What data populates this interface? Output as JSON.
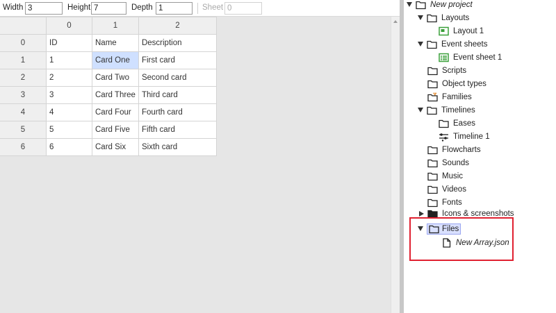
{
  "toolbar": {
    "width_label": "Width",
    "width_value": "3",
    "height_label": "Height",
    "height_value": "7",
    "depth_label": "Depth",
    "depth_value": "1",
    "sheet_label": "Sheet",
    "sheet_value": "0"
  },
  "grid": {
    "columns": [
      "0",
      "1",
      "2"
    ],
    "rows": [
      {
        "index": "0",
        "cells": [
          "ID",
          "Name",
          "Description"
        ]
      },
      {
        "index": "1",
        "cells": [
          "1",
          "Card One",
          "First card"
        ]
      },
      {
        "index": "2",
        "cells": [
          "2",
          "Card Two",
          "Second card"
        ]
      },
      {
        "index": "3",
        "cells": [
          "3",
          "Card Three",
          "Third card"
        ]
      },
      {
        "index": "4",
        "cells": [
          "4",
          "Card Four",
          "Fourth card"
        ]
      },
      {
        "index": "5",
        "cells": [
          "5",
          "Card Five",
          "Fifth card"
        ]
      },
      {
        "index": "6",
        "cells": [
          "6",
          "Card Six",
          "Sixth card"
        ]
      }
    ],
    "selected_cell": "Card One"
  },
  "project": {
    "root": "New project",
    "layouts": "Layouts",
    "layout_1": "Layout 1",
    "event_sheets": "Event sheets",
    "event_sheet_1": "Event sheet 1",
    "scripts": "Scripts",
    "object_types": "Object types",
    "families": "Families",
    "timelines": "Timelines",
    "eases": "Eases",
    "timeline_1": "Timeline 1",
    "flowcharts": "Flowcharts",
    "sounds": "Sounds",
    "music": "Music",
    "videos": "Videos",
    "fonts": "Fonts",
    "icons_screenshots": "Icons & screenshots",
    "files": "Files",
    "new_array": "New Array.json"
  },
  "colors": {
    "highlight": "#e02030",
    "layout_icon": "#3aa03a",
    "event_icon": "#3aa03a",
    "families_accent": "#e07a10",
    "selected_cell": "#cfe0ff"
  }
}
